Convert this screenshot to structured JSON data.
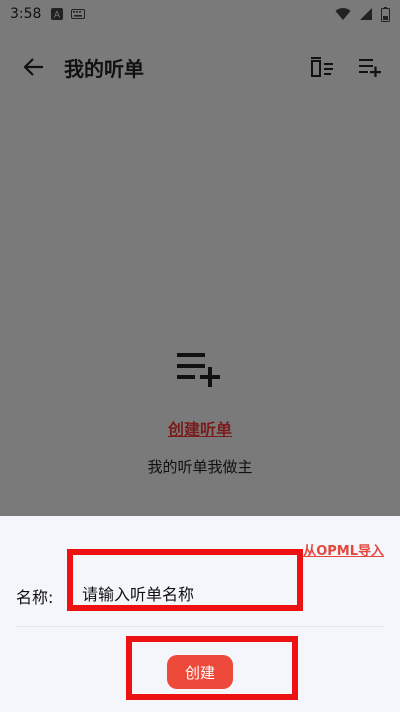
{
  "status_bar": {
    "time": "3:58"
  },
  "app_bar": {
    "title": "我的听单"
  },
  "empty_state": {
    "create_link": "创建听单",
    "slogan": "我的听单我做主"
  },
  "sheet": {
    "import_link": "从OPML导入",
    "name_label": "名称:",
    "name_placeholder": "请输入听单名称",
    "name_value": "",
    "create_button": "创建"
  },
  "colors": {
    "accent": "#ee4a3c",
    "link_dark": "#7a1c1c",
    "highlight": "#ee1111",
    "overlay": "#7a7a7a",
    "sheet_bg": "#f4f6fb"
  }
}
